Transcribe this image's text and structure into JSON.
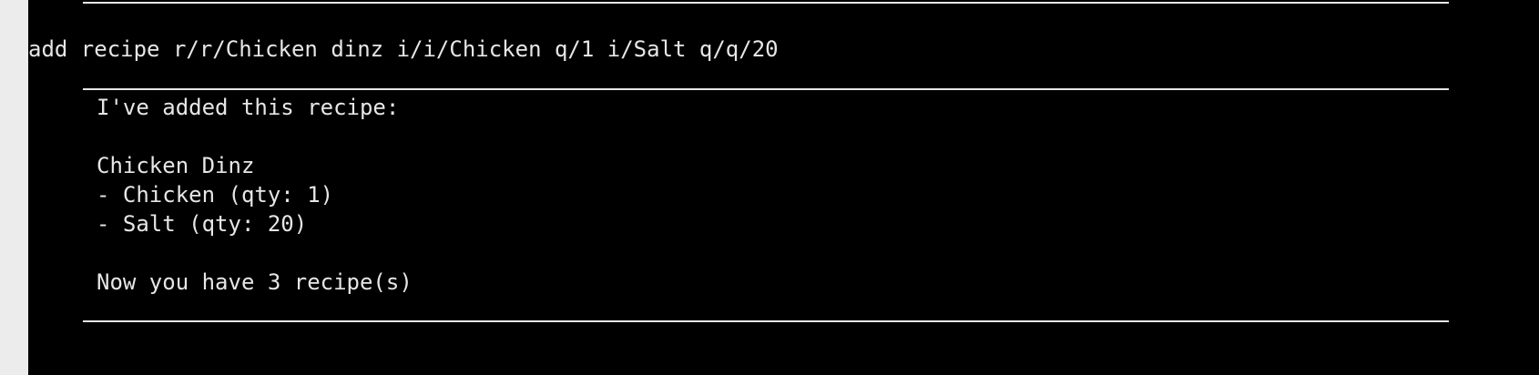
{
  "terminal": {
    "command": "add recipe r/r/Chicken dinz i/i/Chicken q/1 i/Salt q/q/20",
    "response": {
      "header": "I've added this recipe:",
      "recipe_name": "Chicken Dinz",
      "ingredients": [
        "- Chicken (qty: 1)",
        "- Salt (qty: 20)"
      ],
      "summary": "Now you have 3 recipe(s)"
    }
  }
}
